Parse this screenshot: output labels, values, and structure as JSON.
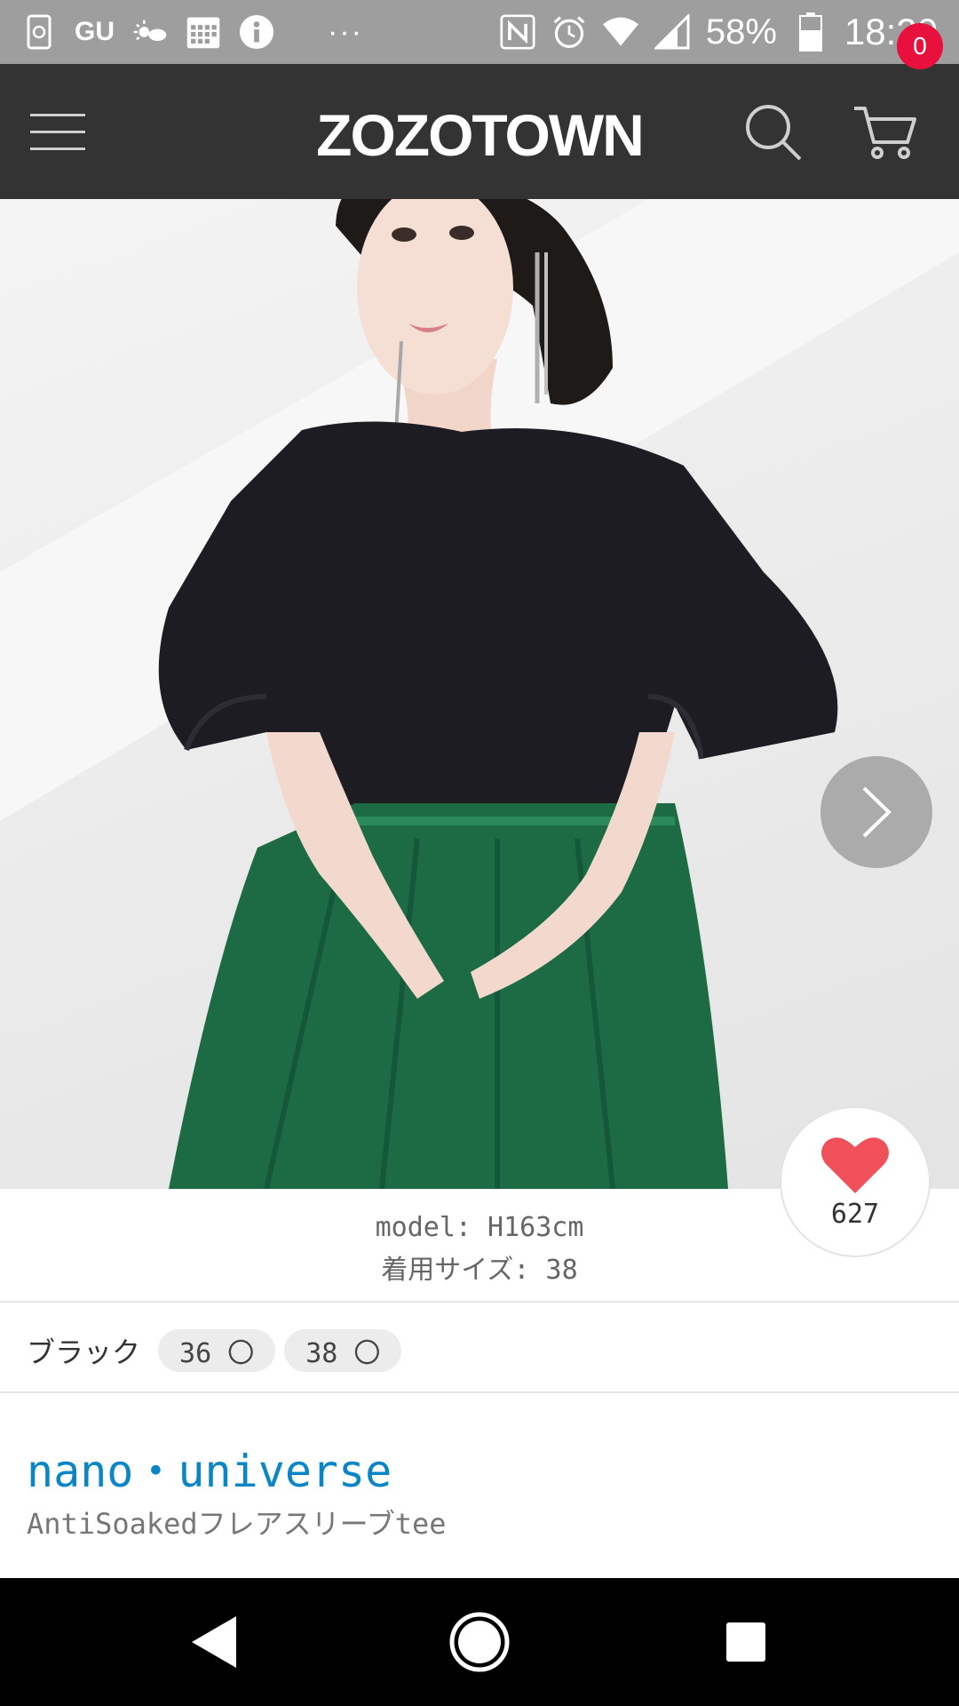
{
  "status_bar": {
    "carrier": "GU",
    "dots": "···",
    "battery_pct": "58%",
    "time": "18:20",
    "icons": [
      "sync-icon",
      "weather-icon",
      "calendar-icon",
      "info-icon",
      "nfc-icon",
      "alarm-icon",
      "wifi-icon",
      "signal-icon",
      "battery-icon"
    ]
  },
  "header": {
    "logo": "ZOZOTOWN",
    "cart_count": "0",
    "icons": [
      "menu-icon",
      "search-icon",
      "cart-icon"
    ]
  },
  "gallery": {
    "icons": [
      "chevron-right-icon",
      "grid-icon"
    ]
  },
  "like": {
    "count": "627",
    "icon": "heart-icon",
    "color": "#f0505a"
  },
  "model_info": {
    "height": "model: H163cm",
    "size": "着用サイズ: 38"
  },
  "variants": {
    "color_name": "ブラック",
    "sizes": [
      {
        "label": "36 〇"
      },
      {
        "label": "38 〇"
      }
    ]
  },
  "product": {
    "brand": "nano・universe",
    "name": "AntiSoakedフレアスリーブtee",
    "brand_color": "#0a86c6"
  },
  "nav": {
    "icons": [
      "back-icon",
      "home-icon",
      "recents-icon"
    ]
  }
}
